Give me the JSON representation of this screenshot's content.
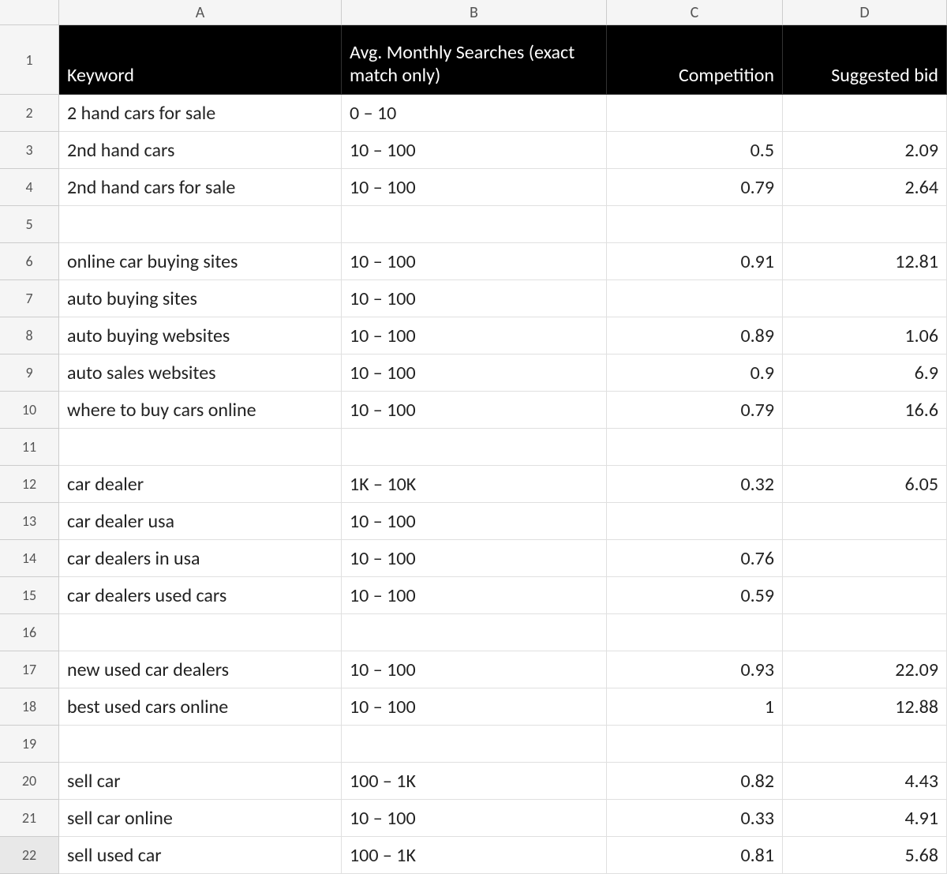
{
  "columns": [
    "A",
    "B",
    "C",
    "D"
  ],
  "headers": {
    "keyword": "Keyword",
    "avg_searches": "Avg. Monthly Searches (exact match only)",
    "competition": "Competition",
    "suggested_bid": "Suggested bid"
  },
  "rows": [
    {
      "num": 2,
      "keyword": "2 hand cars for sale",
      "avg_searches": "0 – 10",
      "competition": "",
      "suggested_bid": ""
    },
    {
      "num": 3,
      "keyword": "2nd hand cars",
      "avg_searches": "10 – 100",
      "competition": "0.5",
      "suggested_bid": "2.09"
    },
    {
      "num": 4,
      "keyword": "2nd hand cars for sale",
      "avg_searches": "10 – 100",
      "competition": "0.79",
      "suggested_bid": "2.64"
    },
    {
      "num": 5,
      "keyword": "",
      "avg_searches": "",
      "competition": "",
      "suggested_bid": ""
    },
    {
      "num": 6,
      "keyword": "online car buying sites",
      "avg_searches": "10 – 100",
      "competition": "0.91",
      "suggested_bid": "12.81"
    },
    {
      "num": 7,
      "keyword": "auto buying sites",
      "avg_searches": "10 – 100",
      "competition": "",
      "suggested_bid": ""
    },
    {
      "num": 8,
      "keyword": "auto buying websites",
      "avg_searches": "10 – 100",
      "competition": "0.89",
      "suggested_bid": "1.06"
    },
    {
      "num": 9,
      "keyword": "auto sales websites",
      "avg_searches": "10 – 100",
      "competition": "0.9",
      "suggested_bid": "6.9"
    },
    {
      "num": 10,
      "keyword": "where to buy cars online",
      "avg_searches": "10 – 100",
      "competition": "0.79",
      "suggested_bid": "16.6"
    },
    {
      "num": 11,
      "keyword": "",
      "avg_searches": "",
      "competition": "",
      "suggested_bid": ""
    },
    {
      "num": 12,
      "keyword": "car dealer",
      "avg_searches": "1K – 10K",
      "competition": "0.32",
      "suggested_bid": "6.05"
    },
    {
      "num": 13,
      "keyword": "car dealer usa",
      "avg_searches": "10 – 100",
      "competition": "",
      "suggested_bid": ""
    },
    {
      "num": 14,
      "keyword": "car dealers in usa",
      "avg_searches": "10 – 100",
      "competition": "0.76",
      "suggested_bid": ""
    },
    {
      "num": 15,
      "keyword": "car dealers used cars",
      "avg_searches": "10 – 100",
      "competition": "0.59",
      "suggested_bid": ""
    },
    {
      "num": 16,
      "keyword": "",
      "avg_searches": "",
      "competition": "",
      "suggested_bid": ""
    },
    {
      "num": 17,
      "keyword": "new used car dealers",
      "avg_searches": "10 – 100",
      "competition": "0.93",
      "suggested_bid": "22.09"
    },
    {
      "num": 18,
      "keyword": "best used cars online",
      "avg_searches": "10 – 100",
      "competition": "1",
      "suggested_bid": "12.88"
    },
    {
      "num": 19,
      "keyword": "",
      "avg_searches": "",
      "competition": "",
      "suggested_bid": ""
    },
    {
      "num": 20,
      "keyword": "sell car",
      "avg_searches": "100 – 1K",
      "competition": "0.82",
      "suggested_bid": "4.43"
    },
    {
      "num": 21,
      "keyword": "sell car online",
      "avg_searches": "10 – 100",
      "competition": "0.33",
      "suggested_bid": "4.91"
    },
    {
      "num": 22,
      "keyword": "sell used car",
      "avg_searches": "100 – 1K",
      "competition": "0.81",
      "suggested_bid": "5.68"
    }
  ],
  "selected_row": 22
}
